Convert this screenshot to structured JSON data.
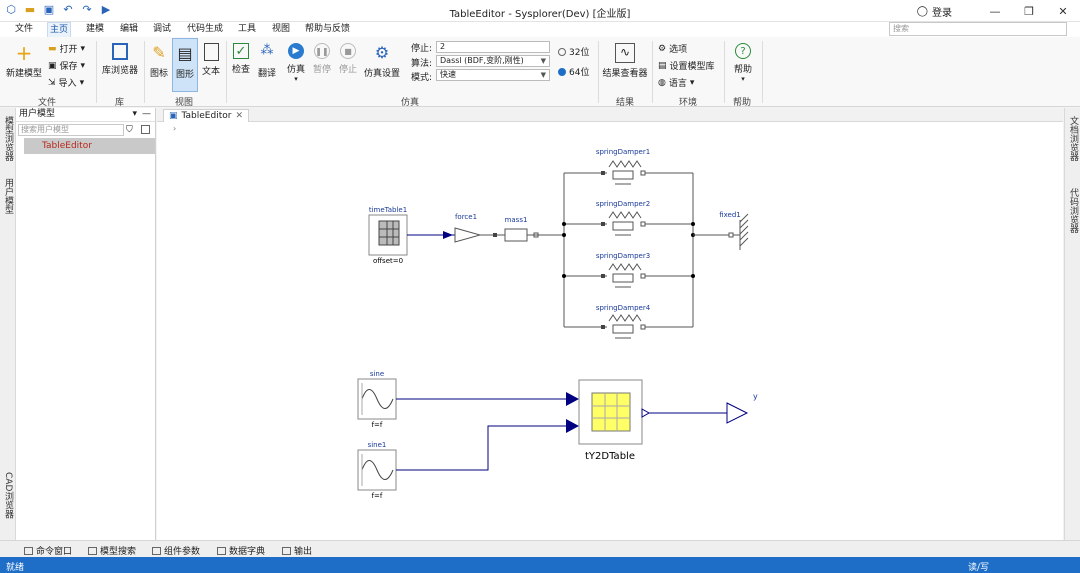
{
  "window": {
    "title": "TableEditor - Sysplorer(Dev) [企业版]",
    "login": "登录"
  },
  "menu": [
    "文件",
    "主页",
    "建模",
    "编辑",
    "调试",
    "代码生成",
    "工具",
    "视图",
    "帮助与反馈"
  ],
  "search_placeholder": "搜索",
  "ribbon": {
    "file": {
      "new_model": "新建模型",
      "open": "打开",
      "save": "保存",
      "import": "导入",
      "label": "文件"
    },
    "lib": {
      "browser": "库浏览器",
      "label": "库"
    },
    "view": {
      "icon": "图标",
      "diagram": "图形",
      "text": "文本",
      "label": "视图"
    },
    "sim": {
      "check": "检查",
      "translate": "翻译",
      "simulate": "仿真",
      "pause": "暂停",
      "stop": "停止",
      "settings": "仿真设置",
      "stop_time_label": "停止:",
      "stop_time": "2",
      "algorithm_label": "算法:",
      "algorithm": "Dassl (BDF,变阶,刚性)",
      "mode_label": "模式:",
      "mode": "快速",
      "bit32": "32位",
      "bit64": "64位",
      "selected_bits": "64位",
      "label": "仿真"
    },
    "result": {
      "viewer": "结果查看器",
      "label": "结果"
    },
    "env": {
      "options": "选项",
      "model_lib": "设置模型库",
      "language": "语言",
      "label": "环境"
    },
    "help": {
      "help": "帮助",
      "label": "帮助"
    }
  },
  "left_tabs": [
    "模型浏览器",
    "用户模型",
    "CAD浏览器"
  ],
  "right_tabs": [
    "文档浏览器",
    "代码浏览器"
  ],
  "panel": {
    "title": "用户模型",
    "search_placeholder": "搜索用户模型",
    "items": [
      "TableEditor"
    ]
  },
  "editor": {
    "tab": "TableEditor",
    "breadcrumb": "›"
  },
  "diagram": {
    "time_table": {
      "name": "timeTable1",
      "param": "offset=0"
    },
    "force": {
      "name": "force1"
    },
    "mass": {
      "name": "mass1"
    },
    "fixed": {
      "name": "fixed1"
    },
    "spring_dampers": [
      "springDamper1",
      "springDamper2",
      "springDamper3",
      "springDamper4"
    ],
    "sine": {
      "name": "sine",
      "param": "f=f"
    },
    "sine1": {
      "name": "sine1",
      "param": "f=f"
    },
    "table2d": {
      "name": "tY2DTable"
    },
    "output": {
      "name": "y"
    }
  },
  "bottom_tabs": [
    "命令窗口",
    "模型搜索",
    "组件参数",
    "数据字典",
    "输出"
  ],
  "status": {
    "left": "就绪",
    "right": "读/写"
  },
  "colors": {
    "accent": "#1e6ec8",
    "connector": "#000080",
    "table_fill": "#ffff66"
  }
}
